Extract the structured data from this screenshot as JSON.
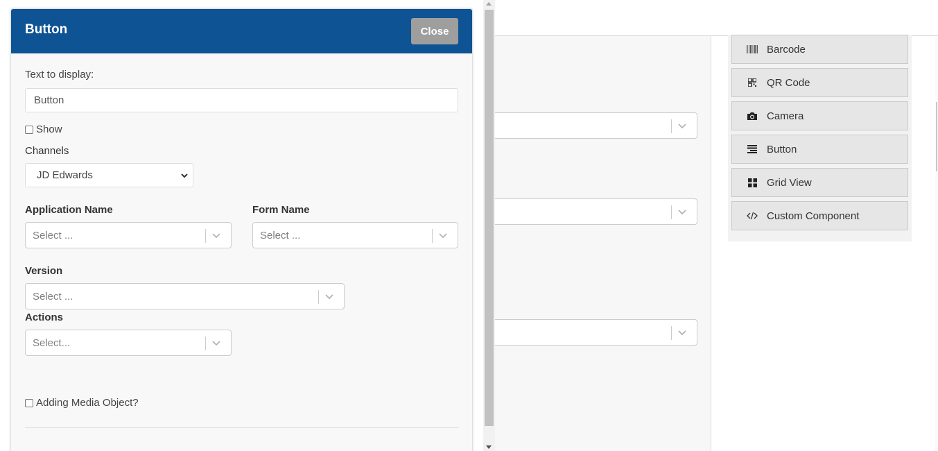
{
  "modal": {
    "title": "Button",
    "close_label": "Close",
    "text_to_display_label": "Text to display:",
    "text_to_display_value": "Button",
    "show_label": "Show",
    "channels_label": "Channels",
    "channels_selected": "JD Edwards",
    "application_name_label": "Application Name",
    "application_name_placeholder": "Select ...",
    "form_name_label": "Form Name",
    "form_name_placeholder": "Select ...",
    "version_label": "Version",
    "version_placeholder": "Select ...",
    "actions_label": "Actions",
    "actions_placeholder": "Select...",
    "media_object_label": "Adding Media Object?"
  },
  "components": {
    "items": [
      {
        "label": "Barcode",
        "icon": "barcode-icon"
      },
      {
        "label": "QR Code",
        "icon": "qr-code-icon"
      },
      {
        "label": "Camera",
        "icon": "camera-icon"
      },
      {
        "label": "Button",
        "icon": "button-icon"
      },
      {
        "label": "Grid View",
        "icon": "grid-icon"
      },
      {
        "label": "Custom Component",
        "icon": "code-icon"
      }
    ]
  },
  "colors": {
    "header": "#0e5394",
    "close_button": "#9e9e9e",
    "component_item": "#e6e6e6"
  }
}
